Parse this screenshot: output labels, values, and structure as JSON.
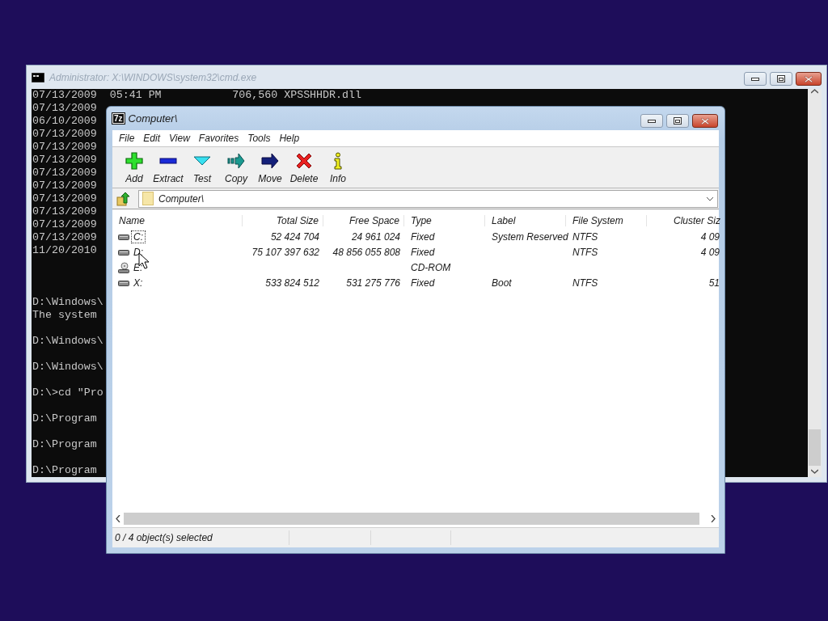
{
  "console_window": {
    "title": "Administrator: X:\\WINDOWS\\system32\\cmd.exe",
    "listing": [
      {
        "text": "07/13/2009  05:41 PM           706,560 XPSSHHDR.dll"
      },
      {
        "text": "07/13/2009"
      },
      {
        "text": "06/10/2009"
      },
      {
        "text": "07/13/2009"
      },
      {
        "text": "07/13/2009"
      },
      {
        "text": "07/13/2009"
      },
      {
        "text": "07/13/2009"
      },
      {
        "text": "07/13/2009"
      },
      {
        "text": "07/13/2009"
      },
      {
        "text": "07/13/2009"
      },
      {
        "text": "07/13/2009"
      },
      {
        "text": "07/13/2009"
      },
      {
        "text": "11/20/2010"
      }
    ],
    "session": [
      [
        "D:\\Windows\\",
        "The system"
      ],
      [
        "D:\\Windows\\"
      ],
      [
        "D:\\Windows\\"
      ],
      [
        "D:\\>cd \"Pro"
      ],
      [
        "D:\\Program"
      ],
      [
        "D:\\Program"
      ],
      [
        "D:\\Program"
      ]
    ]
  },
  "archiver_window": {
    "icon_text": "7z",
    "title": "Computer\\",
    "menu": [
      "File",
      "Edit",
      "View",
      "Favorites",
      "Tools",
      "Help"
    ],
    "toolbar": [
      {
        "label": "Add",
        "kind": "add"
      },
      {
        "label": "Extract",
        "kind": "extract"
      },
      {
        "label": "Test",
        "kind": "test"
      },
      {
        "label": "Copy",
        "kind": "copy"
      },
      {
        "label": "Move",
        "kind": "move"
      },
      {
        "label": "Delete",
        "kind": "delete"
      },
      {
        "label": "Info",
        "kind": "info"
      }
    ],
    "address": "Computer\\",
    "columns": [
      "Name",
      "Total Size",
      "Free Space",
      "Type",
      "Label",
      "File System",
      "Cluster Siz"
    ],
    "rows": [
      {
        "kind": "disk",
        "focused": true,
        "name": "C:",
        "total_size": "52 424 704",
        "free_space": "24 961 024",
        "type": "Fixed",
        "label": "System Reserved",
        "file_system": "NTFS",
        "cluster_size": "4 09"
      },
      {
        "kind": "disk",
        "focused": false,
        "name": "D:",
        "total_size": "75 107 397 632",
        "free_space": "48 856 055 808",
        "type": "Fixed",
        "file_system": "NTFS",
        "cluster_size": "4 09"
      },
      {
        "kind": "cdrom",
        "focused": false,
        "name": "E:",
        "type": "CD-ROM"
      },
      {
        "kind": "disk",
        "focused": false,
        "name": "X:",
        "total_size": "533 824 512",
        "free_space": "531 275 776",
        "type": "Fixed",
        "label": "Boot",
        "file_system": "NTFS",
        "cluster_size": "51"
      }
    ],
    "status": "0 / 4 object(s) selected"
  }
}
